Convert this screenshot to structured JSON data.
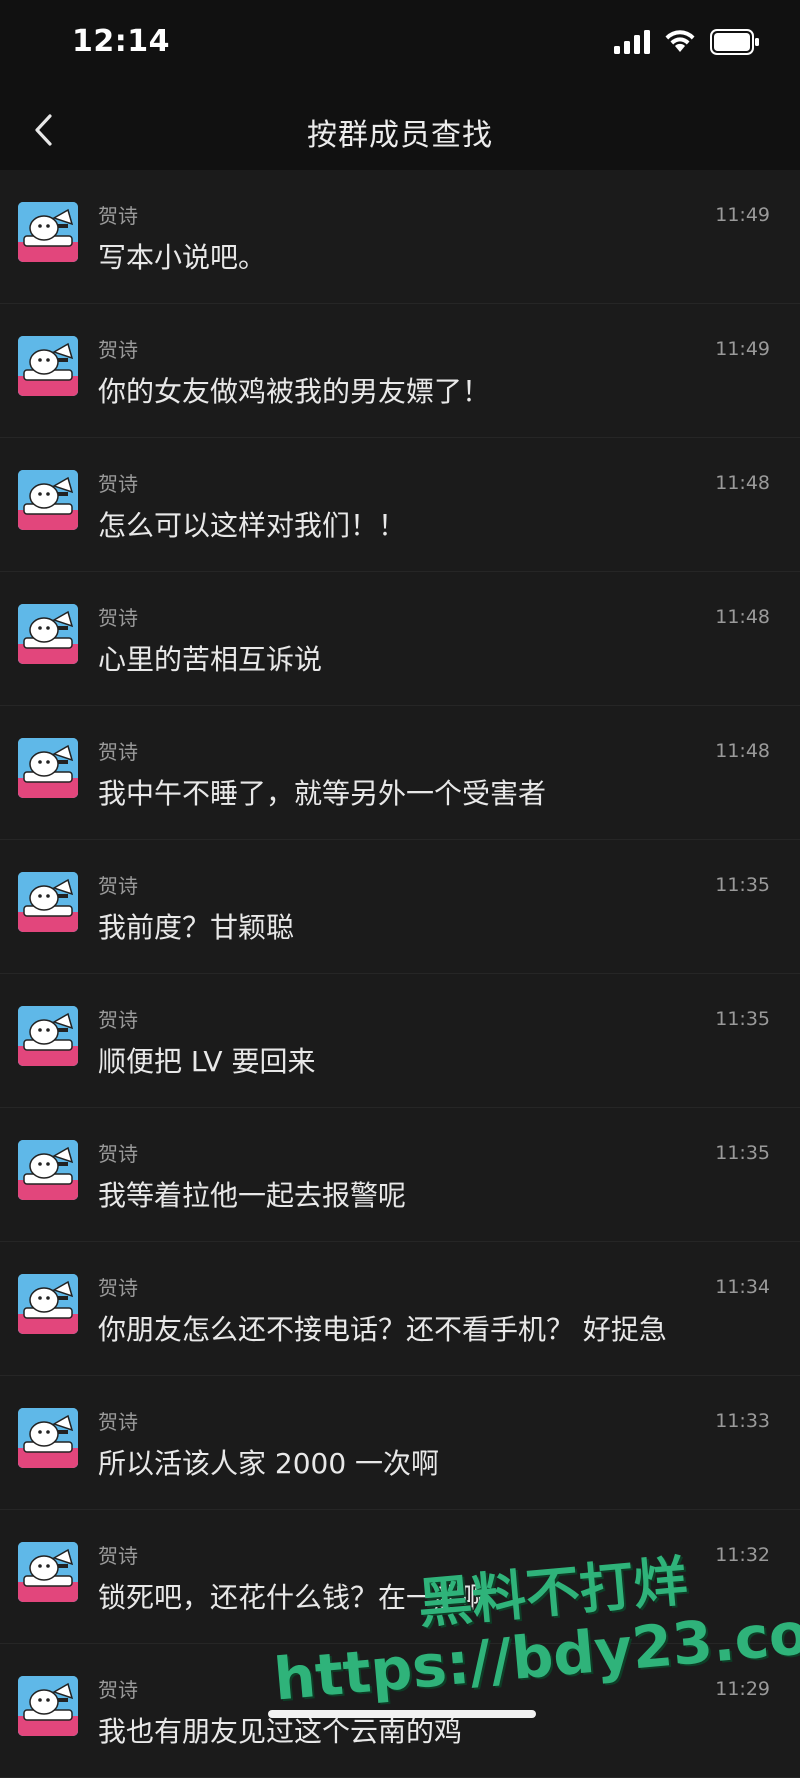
{
  "status_bar": {
    "time": "12:14",
    "icons": [
      "signal-icon",
      "wifi-icon",
      "battery-icon"
    ]
  },
  "nav": {
    "back_icon": "chevron-left-icon",
    "title": "按群成员查找"
  },
  "messages": [
    {
      "sender": "贺诗",
      "time": "11:49",
      "text": "写本小说吧。"
    },
    {
      "sender": "贺诗",
      "time": "11:49",
      "text": "你的女友做鸡被我的男友嫖了！"
    },
    {
      "sender": "贺诗",
      "time": "11:48",
      "text": "怎么可以这样对我们！！"
    },
    {
      "sender": "贺诗",
      "time": "11:48",
      "text": "心里的苦相互诉说"
    },
    {
      "sender": "贺诗",
      "time": "11:48",
      "text": "我中午不睡了，就等另外一个受害者"
    },
    {
      "sender": "贺诗",
      "time": "11:35",
      "text": "我前度？甘颖聪"
    },
    {
      "sender": "贺诗",
      "time": "11:35",
      "text": "顺便把 LV 要回来"
    },
    {
      "sender": "贺诗",
      "time": "11:35",
      "text": "我等着拉他一起去报警呢"
    },
    {
      "sender": "贺诗",
      "time": "11:34",
      "text": "你朋友怎么还不接电话？还不看手机？ 好捉急"
    },
    {
      "sender": "贺诗",
      "time": "11:33",
      "text": "所以活该人家 2000 一次啊"
    },
    {
      "sender": "贺诗",
      "time": "11:32",
      "text": "锁死吧，还花什么钱？在一起啊"
    },
    {
      "sender": "贺诗",
      "time": "11:29",
      "text": "我也有朋友见过这个云南的鸡"
    }
  ],
  "watermark": {
    "line1": "黑料不打烊",
    "line2": "https://bdy23.co"
  },
  "colors": {
    "background": "#1b1b1b",
    "header": "#111111",
    "secondary_text": "#9a9a9a",
    "watermark": "#2fb37a"
  }
}
